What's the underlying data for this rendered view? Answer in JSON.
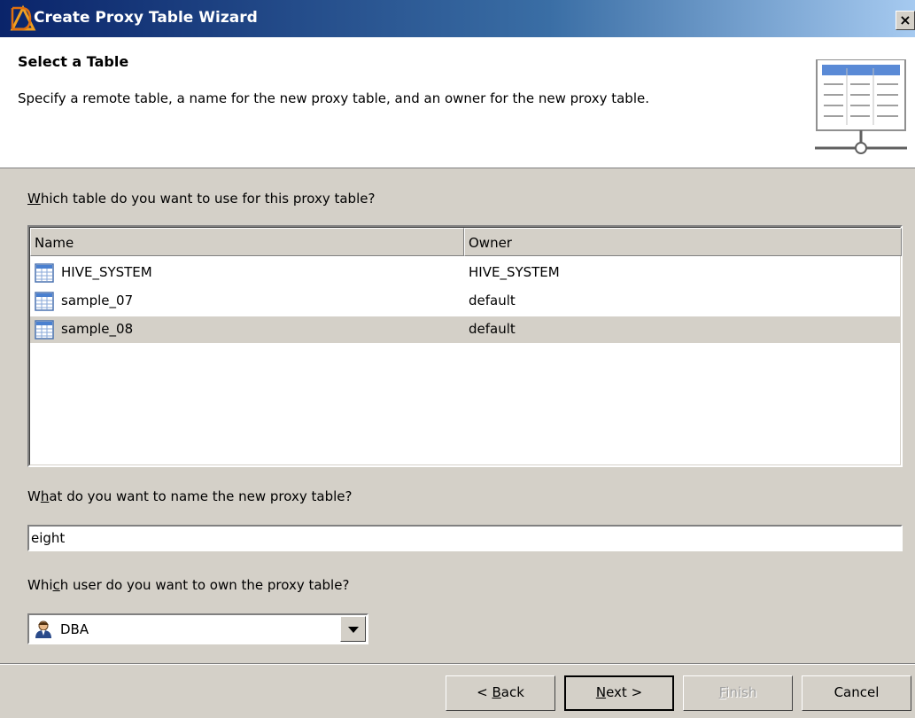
{
  "window": {
    "title": "Create Proxy Table Wizard",
    "close_label": "×"
  },
  "header": {
    "title": "Select a Table",
    "description": "Specify a remote table, a name for the new proxy table, and an owner for the new proxy table."
  },
  "table_question": {
    "pre": "",
    "key": "W",
    "post": "hich table do you want to use for this proxy table?"
  },
  "table_list": {
    "columns": [
      "Name",
      "Owner"
    ],
    "rows": [
      {
        "name": "HIVE_SYSTEM",
        "owner": "HIVE_SYSTEM"
      },
      {
        "name": "sample_07",
        "owner": "default"
      },
      {
        "name": "sample_08",
        "owner": "default"
      }
    ]
  },
  "name_question": {
    "pre": "W",
    "key": "h",
    "post": "at do you want to name the new proxy table?"
  },
  "name_field": {
    "value": "eight"
  },
  "owner_question": {
    "pre": "Whi",
    "key": "c",
    "post": "h user do you want to own the proxy table?"
  },
  "owner_select": {
    "value": "DBA"
  },
  "buttons": {
    "back": {
      "pre": "< ",
      "key": "B",
      "post": "ack"
    },
    "next": {
      "pre": "",
      "key": "N",
      "post": "ext >"
    },
    "finish": {
      "pre": "",
      "key": "F",
      "post": "inish"
    },
    "cancel": {
      "pre": "",
      "key": "",
      "post": "Cancel"
    }
  }
}
